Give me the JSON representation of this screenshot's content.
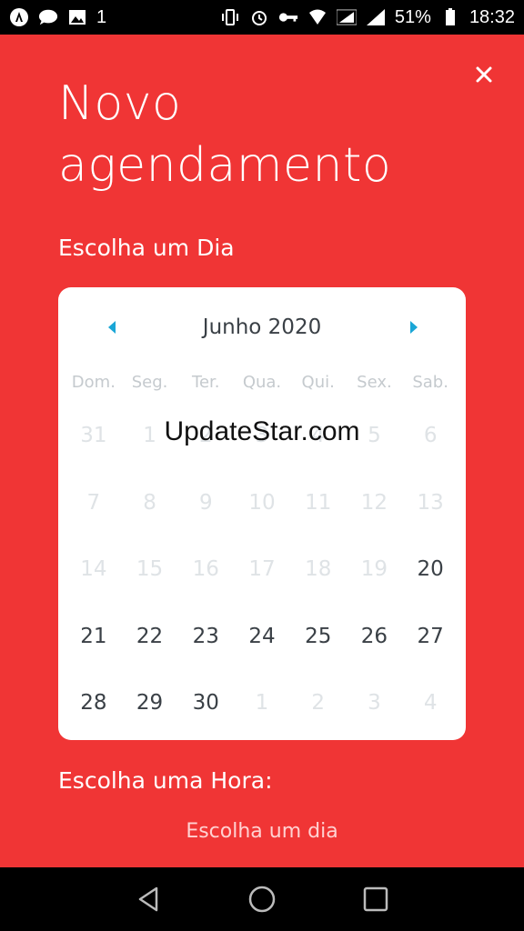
{
  "status_bar": {
    "battery": "51%",
    "time": "18:32",
    "left_icons": [
      "app-icon",
      "chat-icon",
      "gallery-icon",
      "one-notification-icon"
    ],
    "right_icons": [
      "vibrate-icon",
      "alarm-icon",
      "key-icon",
      "wifi-icon",
      "signal-icon",
      "signal-icon",
      "battery-icon"
    ],
    "left_badge": "1"
  },
  "screen": {
    "title_line1": "Novo",
    "title_line2": "agendamento",
    "day_section_label": "Escolha um Dia",
    "hour_section_label": "Escolha uma Hora:",
    "hour_placeholder": "Escolha um dia",
    "accent_color": "#f03535"
  },
  "calendar": {
    "month_label": "Junho 2020",
    "weekdays": [
      "Dom.",
      "Seg.",
      "Ter.",
      "Qua.",
      "Qui.",
      "Sex.",
      "Sab."
    ],
    "arrow_color": "#1aa6d6",
    "days": [
      {
        "label": "31",
        "enabled": false
      },
      {
        "label": "1",
        "enabled": false
      },
      {
        "label": "2",
        "enabled": false
      },
      {
        "label": "3",
        "enabled": false
      },
      {
        "label": "4",
        "enabled": false
      },
      {
        "label": "5",
        "enabled": false
      },
      {
        "label": "6",
        "enabled": false
      },
      {
        "label": "7",
        "enabled": false
      },
      {
        "label": "8",
        "enabled": false
      },
      {
        "label": "9",
        "enabled": false
      },
      {
        "label": "10",
        "enabled": false
      },
      {
        "label": "11",
        "enabled": false
      },
      {
        "label": "12",
        "enabled": false
      },
      {
        "label": "13",
        "enabled": false
      },
      {
        "label": "14",
        "enabled": false
      },
      {
        "label": "15",
        "enabled": false
      },
      {
        "label": "16",
        "enabled": false
      },
      {
        "label": "17",
        "enabled": false
      },
      {
        "label": "18",
        "enabled": false
      },
      {
        "label": "19",
        "enabled": false
      },
      {
        "label": "20",
        "enabled": true
      },
      {
        "label": "21",
        "enabled": true
      },
      {
        "label": "22",
        "enabled": true
      },
      {
        "label": "23",
        "enabled": true
      },
      {
        "label": "24",
        "enabled": true
      },
      {
        "label": "25",
        "enabled": true
      },
      {
        "label": "26",
        "enabled": true
      },
      {
        "label": "27",
        "enabled": true
      },
      {
        "label": "28",
        "enabled": true
      },
      {
        "label": "29",
        "enabled": true
      },
      {
        "label": "30",
        "enabled": true
      },
      {
        "label": "1",
        "enabled": false
      },
      {
        "label": "2",
        "enabled": false
      },
      {
        "label": "3",
        "enabled": false
      },
      {
        "label": "4",
        "enabled": false
      }
    ]
  },
  "watermark": "UpdateStar.com",
  "nav_bar": {
    "icons": [
      "back-icon",
      "home-icon",
      "recents-icon"
    ]
  }
}
